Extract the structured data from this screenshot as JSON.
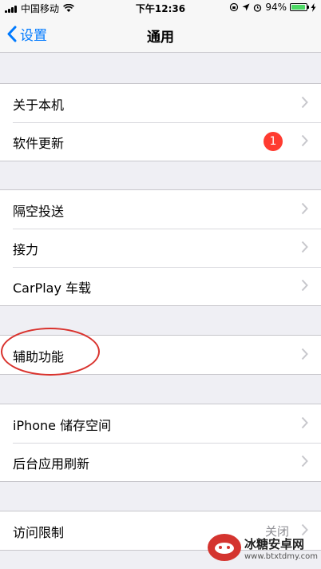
{
  "status_bar": {
    "carrier": "中国移动",
    "time": "下午12:36",
    "battery_percent": "94%",
    "battery_level": 0.94,
    "icons": [
      "signal-icon",
      "wifi-icon",
      "rotation-lock-icon",
      "location-icon",
      "alarm-icon",
      "battery-icon",
      "charging-icon"
    ]
  },
  "nav": {
    "back_label": "设置",
    "title": "通用"
  },
  "groups": [
    {
      "items": [
        {
          "label": "关于本机"
        },
        {
          "label": "软件更新",
          "badge": "1"
        }
      ]
    },
    {
      "items": [
        {
          "label": "隔空投送"
        },
        {
          "label": "接力"
        },
        {
          "label": "CarPlay 车载"
        }
      ]
    },
    {
      "items": [
        {
          "label": "辅助功能"
        }
      ]
    },
    {
      "items": [
        {
          "label": "iPhone 储存空间"
        },
        {
          "label": "后台应用刷新"
        }
      ]
    },
    {
      "items": [
        {
          "label": "访问限制",
          "detail": "关闭"
        }
      ]
    }
  ],
  "watermark": {
    "title": "冰糖安卓网",
    "url": "www.btxtdmy.com"
  },
  "colors": {
    "accent": "#007aff",
    "badge": "#ff3b30",
    "highlight_ellipse": "#d9322d",
    "background": "#efeff4",
    "battery_fill": "#4cd964"
  }
}
